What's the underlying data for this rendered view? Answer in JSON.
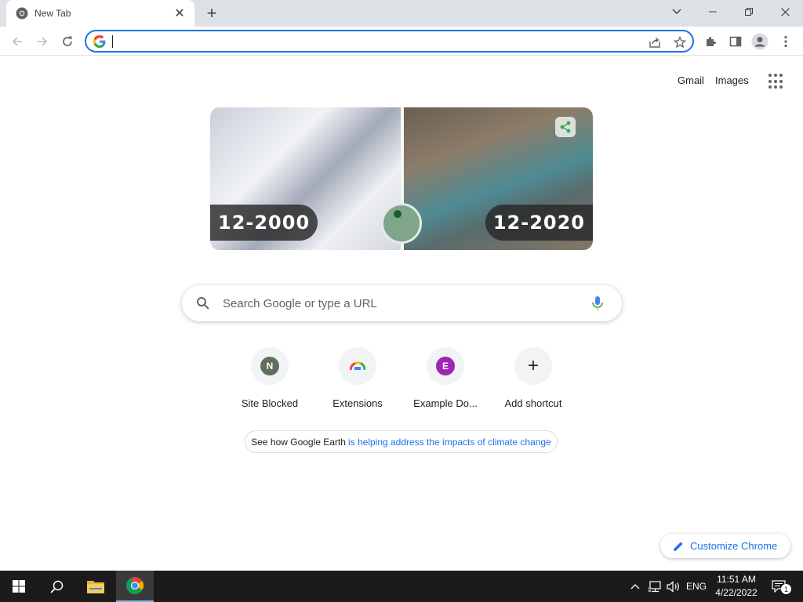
{
  "tab": {
    "title": "New Tab",
    "close_glyph": "✕"
  },
  "newtab_glyph": "+",
  "omnibox": {
    "value": "",
    "placeholder": ""
  },
  "top_links": {
    "gmail": "Gmail",
    "images": "Images"
  },
  "doodle": {
    "left_label": "12-2000",
    "right_label": "12-2020"
  },
  "search": {
    "placeholder": "Search Google or type a URL"
  },
  "shortcuts": [
    {
      "label": "Site Blocked",
      "letter": "N",
      "color": "#5f6f5c"
    },
    {
      "label": "Extensions",
      "icon": "chrome-rainbow-icon"
    },
    {
      "label": "Example Do...",
      "letter": "E",
      "color": "#9c27b0"
    },
    {
      "label": "Add shortcut",
      "icon": "plus-icon",
      "glyph": "+"
    }
  ],
  "promo": {
    "plain": "See how Google Earth",
    "link": "is helping address the impacts of climate change"
  },
  "customize": {
    "label": "Customize Chrome"
  },
  "taskbar": {
    "language": "ENG",
    "time": "11:51 AM",
    "date": "4/22/2022",
    "notification_count": "1"
  },
  "colors": {
    "accent": "#1a73e8",
    "tabstrip": "#dee1e6",
    "taskbar": "#1b1b1b"
  }
}
